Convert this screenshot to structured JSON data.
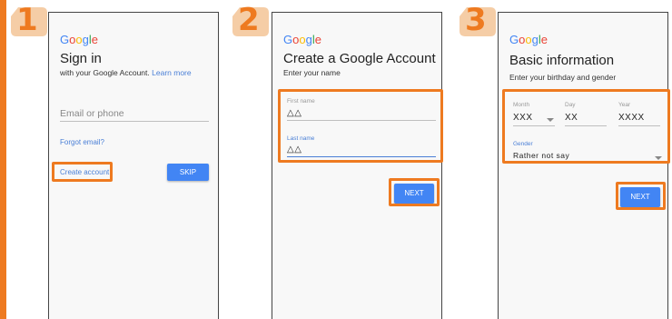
{
  "steps": [
    "1",
    "2",
    "3"
  ],
  "brand": {
    "logo_text": "Google",
    "logo_colors": [
      "#4285F4",
      "#EA4335",
      "#FBBC05",
      "#4285F4",
      "#34A853",
      "#EA4335"
    ],
    "accent": "#ee7a20"
  },
  "screen1": {
    "title": "Sign in",
    "subtitle": "with your Google Account.",
    "learn_more": "Learn more",
    "email_placeholder": "Email or phone",
    "forgot_email": "Forgot email?",
    "create_account": "Create account",
    "skip": "SKIP"
  },
  "screen2": {
    "title": "Create a Google Account",
    "subtitle": "Enter your name",
    "first_name_label": "First name",
    "first_name_value": "△△",
    "last_name_label": "Last name",
    "last_name_value": "△△",
    "next": "NEXT"
  },
  "screen3": {
    "title": "Basic information",
    "subtitle": "Enter your birthday and gender",
    "month_label": "Month",
    "month_value": "XXX",
    "day_label": "Day",
    "day_value": "XX",
    "year_label": "Year",
    "year_value": "XXXX",
    "gender_label": "Gender",
    "gender_value": "Rather not say",
    "next": "NEXT"
  }
}
